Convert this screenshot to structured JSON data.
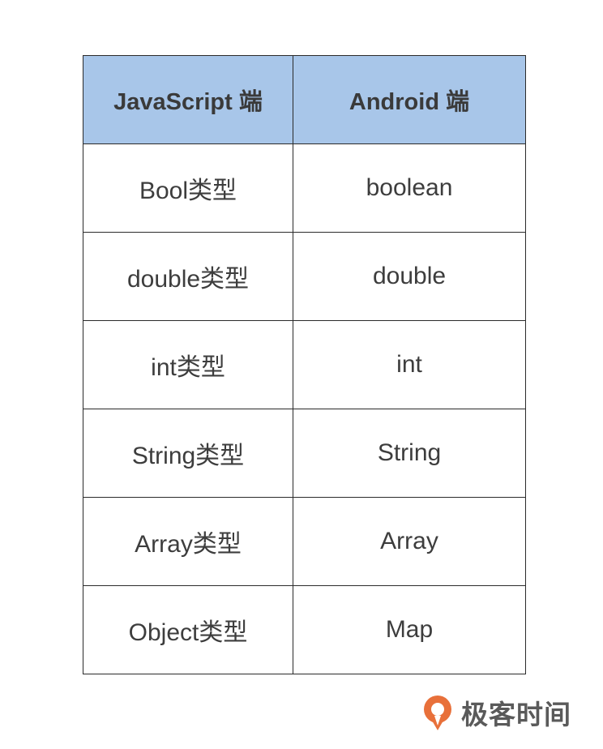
{
  "table": {
    "headers": [
      "JavaScript 端",
      "Android 端"
    ],
    "rows": [
      [
        "Bool类型",
        "boolean"
      ],
      [
        "double类型",
        "double"
      ],
      [
        "int类型",
        "int"
      ],
      [
        "String类型",
        "String"
      ],
      [
        "Array类型",
        "Array"
      ],
      [
        "Object类型",
        "Map"
      ]
    ],
    "header_bg": "#a8c6e9"
  },
  "brand": {
    "name": "极客时间",
    "icon": "geektime-logo-icon",
    "accent": "#e8703a"
  }
}
